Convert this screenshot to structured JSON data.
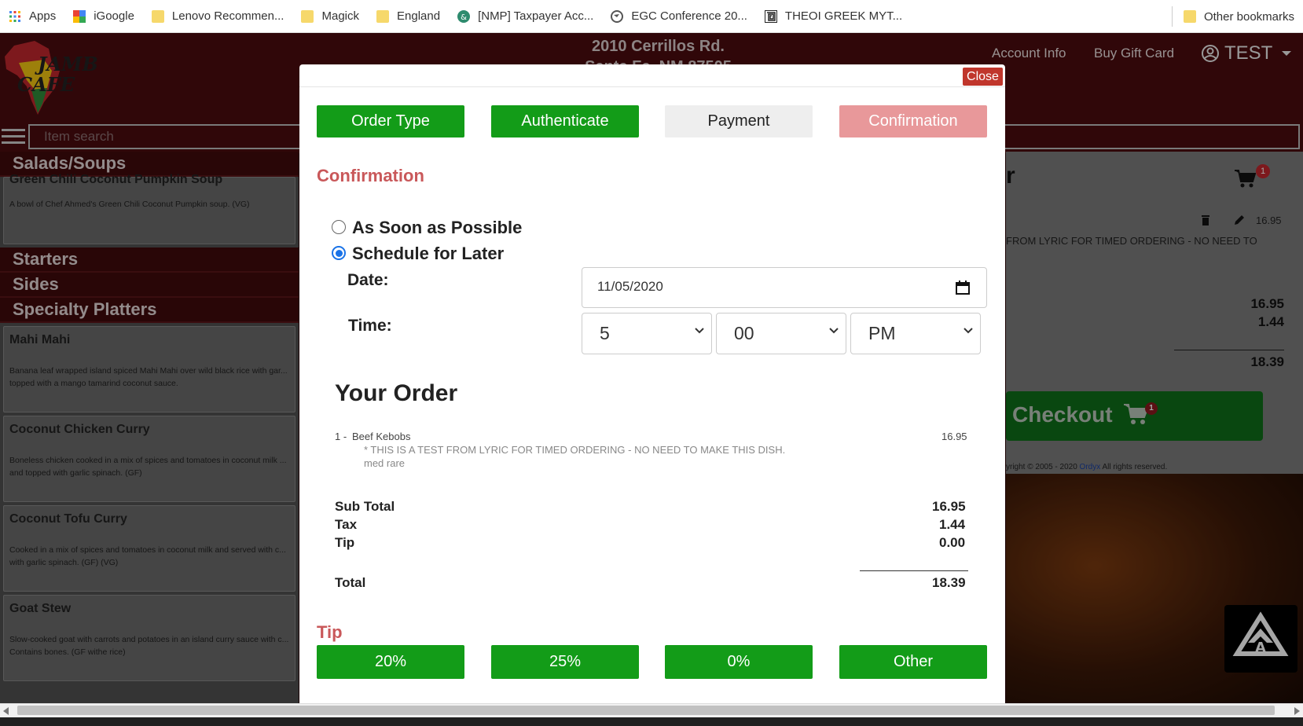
{
  "bookmarks": {
    "items": [
      {
        "label": "Apps",
        "icon": "apps-grid-icon"
      },
      {
        "label": "iGoogle",
        "icon": "igoogle-icon"
      },
      {
        "label": "Lenovo Recommen...",
        "icon": "folder-icon"
      },
      {
        "label": "Magick",
        "icon": "folder-icon"
      },
      {
        "label": "England",
        "icon": "folder-icon"
      },
      {
        "label": "[NMP] Taxpayer Acc...",
        "icon": "site-icon"
      },
      {
        "label": "EGC Conference 20...",
        "icon": "globe-icon"
      },
      {
        "label": "THEOI GREEK MYT...",
        "icon": "theoi-icon"
      }
    ],
    "other": "Other bookmarks"
  },
  "header": {
    "logo_text": "JAMBO CAFE",
    "address_line1": "2010 Cerrillos Rd.",
    "address_line2": "Santa Fe, NM 87505",
    "account_info": "Account Info",
    "buy_gift_card": "Buy Gift Card",
    "user": "TEST",
    "search_placeholder": "Item search"
  },
  "menu": {
    "categories": {
      "salads": "Salads/Soups",
      "starters": "Starters",
      "sides": "Sides",
      "platters": "Specialty Platters"
    },
    "soup_partial_name": "Green Chili Coconut Pumpkin Soup",
    "soup_desc": "A bowl of Chef Ahmed's Green Chili Coconut Pumpkin soup. (VG)",
    "items": [
      {
        "name": "Mahi Mahi",
        "desc": "Banana leaf wrapped island spiced Mahi Mahi over wild black rice with gar... topped with a mango tamarind coconut sauce."
      },
      {
        "name": "Coconut Chicken Curry",
        "desc": "Boneless chicken cooked in a mix of spices and tomatoes in coconut milk ... and topped with garlic spinach. (GF)"
      },
      {
        "name": "Coconut Tofu Curry",
        "desc": "Cooked in a mix of spices and tomatoes in coconut milk and served with c... with garlic spinach. (GF) (VG)"
      },
      {
        "name": "Goat Stew",
        "desc": "Slow-cooked goat with carrots and potatoes in an island curry sauce with c... Contains bones. (GF withe rice)"
      }
    ]
  },
  "cart": {
    "badge": "1",
    "title_fragment": "r",
    "item_price": "16.95",
    "note_fragment": "FROM LYRIC FOR TIMED ORDERING - NO NEED TO",
    "subtotal": "16.95",
    "tax": "1.44",
    "total": "18.39",
    "checkout_label": "Checkout",
    "footer_prefix": "yright © 2005 - 2020 ",
    "footer_link": "Ordyx",
    "footer_suffix": " All rights reserved."
  },
  "modal": {
    "close_label": "Close",
    "steps": [
      "Order Type",
      "Authenticate",
      "Payment",
      "Confirmation"
    ],
    "heading": "Confirmation",
    "radio_asap": "As Soon as Possible",
    "radio_later": "Schedule for Later",
    "selected_option": "Schedule for Later",
    "date_label": "Date:",
    "date_value": "11/05/2020",
    "time_label": "Time:",
    "hour": "5",
    "minute": "00",
    "ampm": "PM",
    "your_order": "Your Order",
    "order_item_qty": "1 -",
    "order_item_name": "Beef Kebobs",
    "order_item_note": "* THIS IS A TEST FROM LYRIC FOR TIMED ORDERING - NO NEED TO MAKE THIS DISH.",
    "order_item_mod": "med rare",
    "order_item_price": "16.95",
    "labels": {
      "subtotal": "Sub Total",
      "tax": "Tax",
      "tip": "Tip",
      "total": "Total"
    },
    "values": {
      "subtotal": "16.95",
      "tax": "1.44",
      "tip": "0.00",
      "total": "18.39"
    },
    "tip_heading": "Tip",
    "tip_options": [
      "20%",
      "25%",
      "0%",
      "Other"
    ]
  },
  "colors": {
    "header": "#4a0b0e",
    "accent_red": "#c9585a",
    "step_done": "#139c18",
    "step_current": "#e8989a",
    "checkout": "#0e6e1a"
  }
}
